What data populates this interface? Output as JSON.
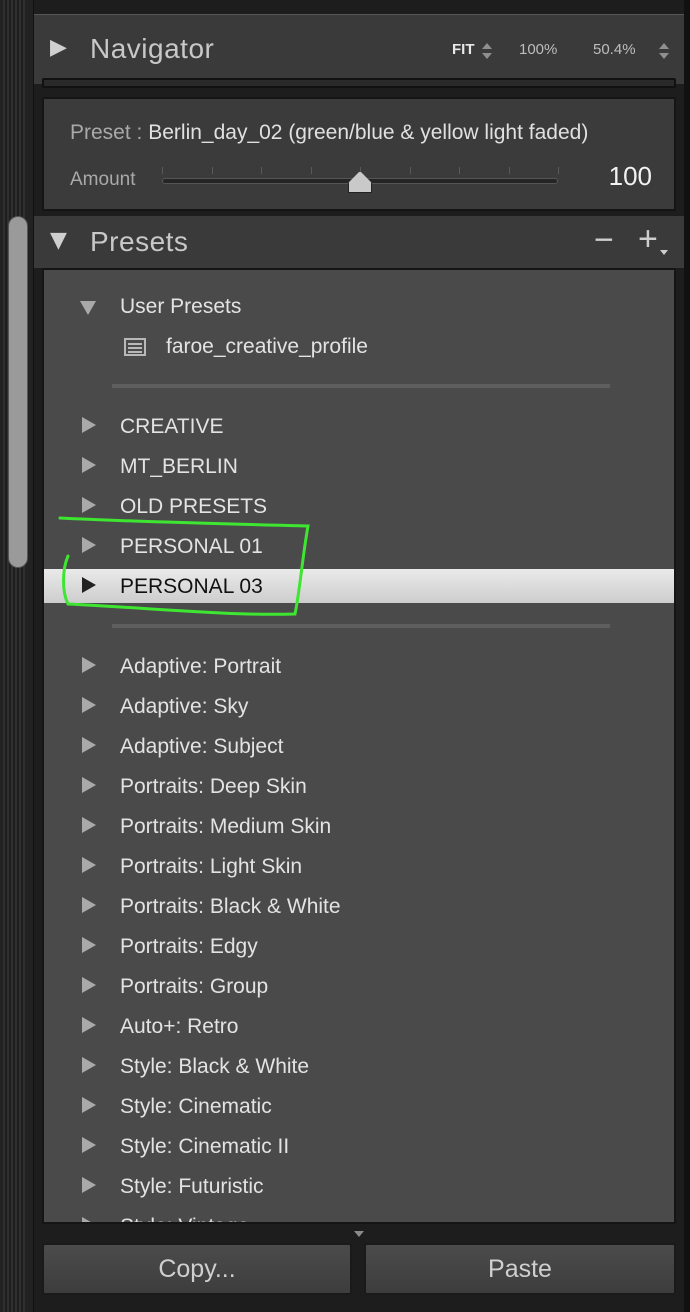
{
  "navigator": {
    "title": "Navigator",
    "zoom_options": [
      "FIT",
      "100%",
      "50.4%"
    ]
  },
  "preset_amount": {
    "preset_label": "Preset :",
    "preset_name": "Berlin_day_02 (green/blue & yellow light faded)",
    "amount_label": "Amount",
    "amount_value": "100",
    "amount_fraction": 0.5
  },
  "presets": {
    "title": "Presets",
    "remove_symbol": "−",
    "add_symbol": "+"
  },
  "preset_list": {
    "user_group": {
      "label": "User Presets",
      "expanded": true,
      "items": [
        {
          "label": "faroe_creative_profile",
          "icon": "preset-list-icon"
        }
      ]
    },
    "folders": [
      {
        "label": "CREATIVE",
        "selected": false
      },
      {
        "label": "MT_BERLIN",
        "selected": false
      },
      {
        "label": "OLD PRESETS",
        "selected": false
      },
      {
        "label": "PERSONAL 01",
        "selected": false
      },
      {
        "label": "PERSONAL 03",
        "selected": true
      }
    ],
    "adaptive_groups": [
      {
        "label": "Adaptive: Portrait"
      },
      {
        "label": "Adaptive: Sky"
      },
      {
        "label": "Adaptive: Subject"
      },
      {
        "label": "Portraits: Deep Skin"
      },
      {
        "label": "Portraits: Medium Skin"
      },
      {
        "label": "Portraits: Light Skin"
      },
      {
        "label": "Portraits: Black & White"
      },
      {
        "label": "Portraits: Edgy"
      },
      {
        "label": "Portraits: Group"
      },
      {
        "label": "Auto+: Retro"
      },
      {
        "label": "Style: Black & White"
      },
      {
        "label": "Style: Cinematic"
      },
      {
        "label": "Style: Cinematic II"
      },
      {
        "label": "Style: Futuristic"
      },
      {
        "label": "Style: Vintage"
      }
    ]
  },
  "buttons": {
    "copy_label": "Copy...",
    "paste_label": "Paste"
  },
  "colors": {
    "annotation_stroke": "#3ee632",
    "selection_bg": "#dcdcdc"
  }
}
